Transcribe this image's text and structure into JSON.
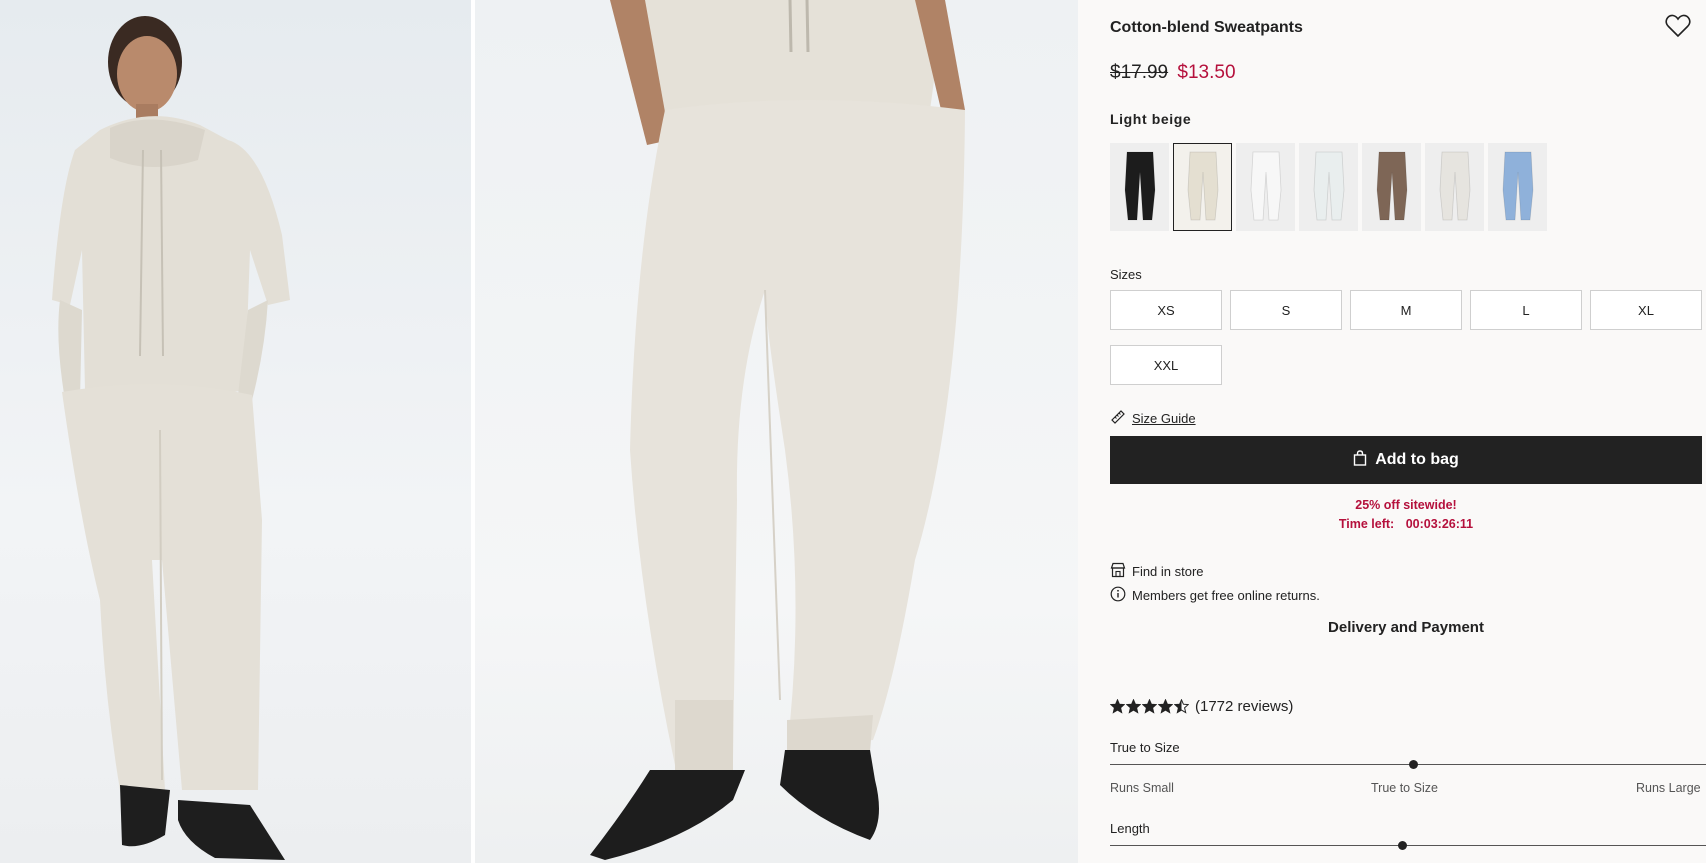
{
  "product": {
    "title": "Cotton-blend Sweatpants",
    "old_price": "$17.99",
    "new_price": "$13.50",
    "selected_color": "Light beige"
  },
  "swatches": [
    {
      "color": "#1c1c1c",
      "bg": "#eeeeee"
    },
    {
      "color": "#e4dfd1",
      "bg": "#f3f1ec",
      "selected": true
    },
    {
      "color": "#f7f7f7",
      "bg": "#eeeeee"
    },
    {
      "color": "#e9eeee",
      "bg": "#eeeeee"
    },
    {
      "color": "#7e6656",
      "bg": "#eeeeee"
    },
    {
      "color": "#e6e4df",
      "bg": "#eeeeee"
    },
    {
      "color": "#8fb1da",
      "bg": "#eeeeee"
    }
  ],
  "sizes": {
    "label": "Sizes",
    "options": [
      "XS",
      "S",
      "M",
      "L",
      "XL",
      "XXL"
    ]
  },
  "size_guide": "Size Guide",
  "add_to_bag": "Add to bag",
  "promo": {
    "headline": "25% off sitewide!",
    "time_left_label": "Time left:",
    "countdown": "00:03:26:11"
  },
  "find_in_store": "Find in store",
  "members_returns": "Members get free online returns.",
  "delivery": "Delivery and Payment",
  "reviews": {
    "rating": 4.5,
    "count_text": "(1772 reviews)"
  },
  "fit": {
    "true_to_size": {
      "label": "True to Size",
      "value": 0.51,
      "low": "Runs Small",
      "mid": "True to Size",
      "high": "Runs Large"
    },
    "length": {
      "label": "Length",
      "value": 0.49
    }
  },
  "colors": {
    "accent_red": "#b5103c",
    "button_dark": "#222222"
  }
}
